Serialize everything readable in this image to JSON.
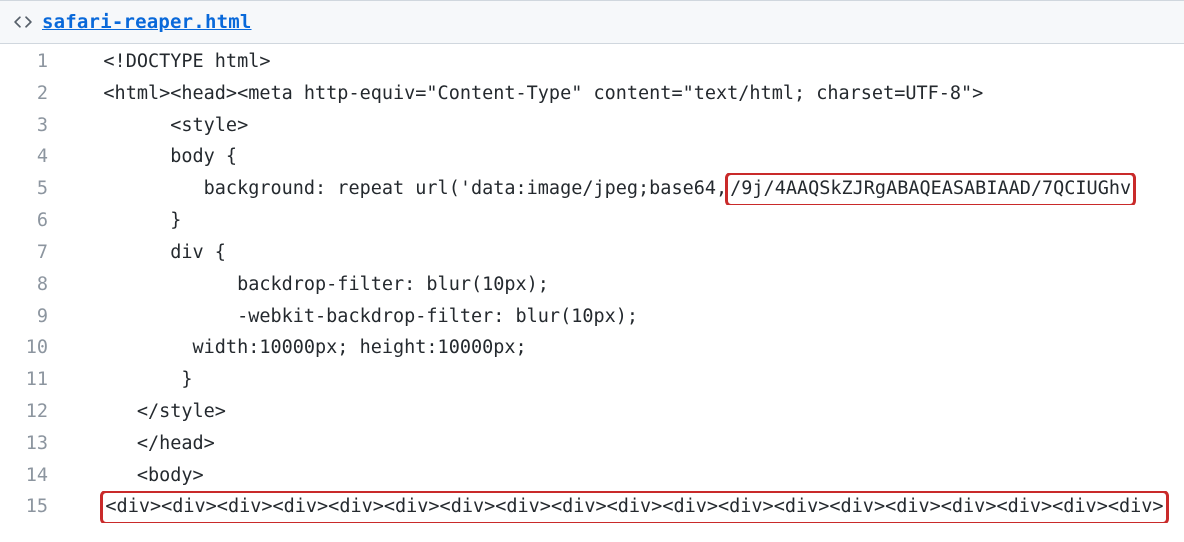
{
  "header": {
    "filename": "safari-reaper.html"
  },
  "lines": [
    {
      "n": 1,
      "indent": "   ",
      "text": "<!DOCTYPE html>",
      "hl": false
    },
    {
      "n": 2,
      "indent": "   ",
      "text": "<html><head><meta http-equiv=\"Content-Type\" content=\"text/html; charset=UTF-8\">",
      "hl": false
    },
    {
      "n": 3,
      "indent": "         ",
      "text": "<style>",
      "hl": false
    },
    {
      "n": 4,
      "indent": "         ",
      "text": "body {",
      "hl": false
    },
    {
      "n": 5,
      "indent": "            ",
      "prefix": "background: repeat url('data:image/jpeg;base64,",
      "hl_text": "/9j/4AAQSkZJRgABAQEASABIAAD/7QCIUGhv",
      "suffix": "",
      "hl": true
    },
    {
      "n": 6,
      "indent": "         ",
      "text": "}",
      "hl": false
    },
    {
      "n": 7,
      "indent": "         ",
      "text": "div {",
      "hl": false
    },
    {
      "n": 8,
      "indent": "               ",
      "text": "backdrop-filter: blur(10px);",
      "hl": false
    },
    {
      "n": 9,
      "indent": "               ",
      "text": "-webkit-backdrop-filter: blur(10px);",
      "hl": false
    },
    {
      "n": 10,
      "indent": "           ",
      "text": "width:10000px; height:10000px;",
      "hl": false
    },
    {
      "n": 11,
      "indent": "          ",
      "text": "}",
      "hl": false
    },
    {
      "n": 12,
      "indent": "      ",
      "text": "</style>",
      "hl": false
    },
    {
      "n": 13,
      "indent": "      ",
      "text": "</head>",
      "hl": false
    },
    {
      "n": 14,
      "indent": "      ",
      "text": "<body>",
      "hl": false
    },
    {
      "n": 15,
      "indent": "   ",
      "prefix": "",
      "hl_text": "<div><div><div><div><div><div><div><div><div><div><div><div><div><div><div><div><div><div><div>",
      "suffix": "",
      "hl": true,
      "hl_class": "last"
    }
  ]
}
